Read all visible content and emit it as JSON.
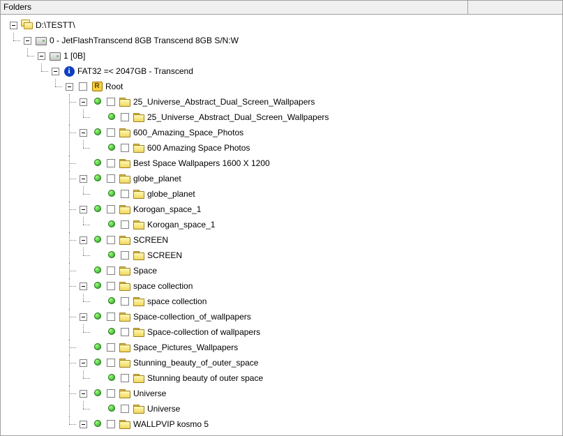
{
  "header": {
    "title": "Folders"
  },
  "root": {
    "path": "D:\\TESTT\\",
    "device": "0 - JetFlashTranscend 8GB Transcend 8GB S/N:W",
    "partition": "1 [0B]",
    "filesystem": "FAT32 =< 2047GB - Transcend",
    "root_label": "Root"
  },
  "folders": [
    {
      "name": "25_Universe_Abstract_Dual_Screen_Wallpapers",
      "exp": "minus",
      "children": [
        {
          "name": "25_Universe_Abstract_Dual_Screen_Wallpapers"
        }
      ]
    },
    {
      "name": "600_Amazing_Space_Photos",
      "exp": "minus",
      "children": [
        {
          "name": "600 Amazing Space Photos"
        }
      ]
    },
    {
      "name": "Best Space Wallpapers 1600 X 1200",
      "exp": null,
      "children": []
    },
    {
      "name": "globe_planet",
      "exp": "minus",
      "children": [
        {
          "name": "globe_planet"
        }
      ]
    },
    {
      "name": "Korogan_space_1",
      "exp": "minus",
      "children": [
        {
          "name": "Korogan_space_1"
        }
      ]
    },
    {
      "name": "SCREEN",
      "exp": "minus",
      "children": [
        {
          "name": "SCREEN"
        }
      ]
    },
    {
      "name": "Space",
      "exp": null,
      "children": []
    },
    {
      "name": "space collection",
      "exp": "minus",
      "children": [
        {
          "name": "space collection"
        }
      ]
    },
    {
      "name": "Space-collection_of_wallpapers",
      "exp": "minus",
      "children": [
        {
          "name": "Space-collection of wallpapers"
        }
      ]
    },
    {
      "name": "Space_Pictures_Wallpapers",
      "exp": null,
      "children": []
    },
    {
      "name": "Stunning_beauty_of_outer_space",
      "exp": "minus",
      "children": [
        {
          "name": "Stunning beauty of outer space"
        }
      ]
    },
    {
      "name": "Universe",
      "exp": "minus",
      "children": [
        {
          "name": "Universe"
        }
      ]
    },
    {
      "name": "WALLPVIP kosmo 5",
      "exp": "minus",
      "children": []
    }
  ]
}
